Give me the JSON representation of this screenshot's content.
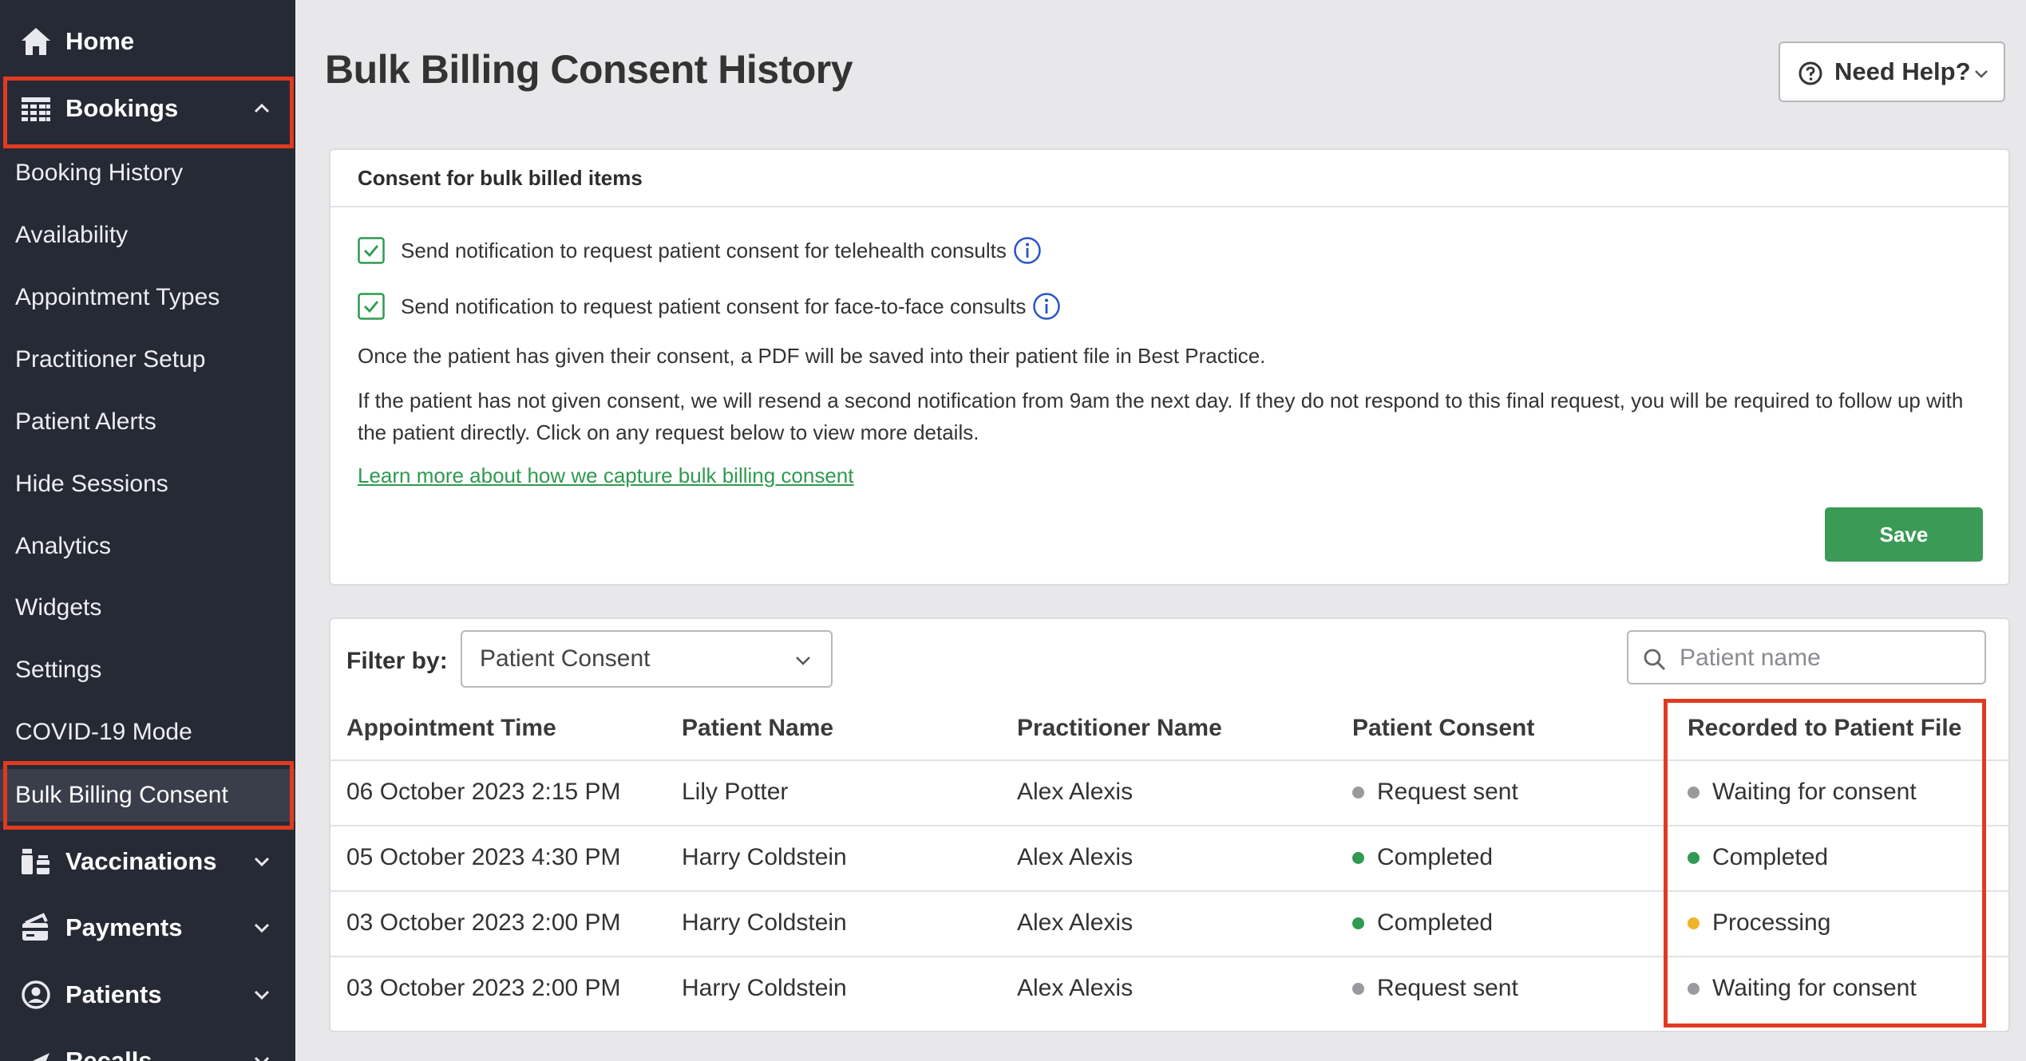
{
  "sidebar": {
    "home_label": "Home",
    "bookings_label": "Bookings",
    "sub_items": [
      {
        "label": "Booking History"
      },
      {
        "label": "Availability"
      },
      {
        "label": "Appointment Types"
      },
      {
        "label": "Practitioner Setup"
      },
      {
        "label": "Patient Alerts"
      },
      {
        "label": "Hide Sessions"
      },
      {
        "label": "Analytics"
      },
      {
        "label": "Widgets"
      },
      {
        "label": "Settings"
      },
      {
        "label": "COVID-19 Mode"
      },
      {
        "label": "Bulk Billing Consent",
        "active": true
      }
    ],
    "vaccinations_label": "Vaccinations",
    "payments_label": "Payments",
    "patients_label": "Patients",
    "recalls_label": "Recalls"
  },
  "header": {
    "title": "Bulk Billing Consent History",
    "help_label": "Need Help?"
  },
  "consent": {
    "heading": "Consent for bulk billed items",
    "telehealth_label": "Send notification to request patient consent for telehealth consults",
    "telehealth_checked": true,
    "face_label": "Send notification to request patient consent for face-to-face consults",
    "face_checked": true,
    "para1": "Once the patient has given their consent, a PDF will be saved into their patient file in Best Practice.",
    "para2": "If the patient has not given consent, we will resend a second notification from 9am the next day. If they do not respond to this final request, you will be required to follow up with the patient directly. Click on any request below to view more details.",
    "learn_link": "Learn more about how we capture bulk billing consent",
    "save_label": "Save"
  },
  "history": {
    "filter_label": "Filter by:",
    "filter_value": "Patient Consent",
    "search_placeholder": "Patient name",
    "columns": [
      "Appointment Time",
      "Patient Name",
      "Practitioner Name",
      "Patient Consent",
      "Recorded to Patient File"
    ],
    "rows": [
      {
        "time": "06 October 2023 2:15 PM",
        "patient": "Lily Potter",
        "practitioner": "Alex Alexis",
        "consent": "Request sent",
        "recorded": "Waiting for consent"
      },
      {
        "time": "05 October 2023 4:30 PM",
        "patient": "Harry Coldstein",
        "practitioner": "Alex Alexis",
        "consent": "Completed",
        "recorded": "Completed"
      },
      {
        "time": "03 October 2023 2:00 PM",
        "patient": "Harry Coldstein",
        "practitioner": "Alex Alexis",
        "consent": "Completed",
        "recorded": "Processing"
      },
      {
        "time": "03 October 2023 2:00 PM",
        "patient": "Harry Coldstein",
        "practitioner": "Alex Alexis",
        "consent": "Request sent",
        "recorded": "Waiting for consent"
      }
    ]
  },
  "colors": {
    "sidebar_bg": "#262a35",
    "accent_green": "#3a9a56",
    "highlight_red": "#e03a21",
    "status_grey": "#9a9a9e",
    "status_green": "#2f9a50",
    "status_amber": "#f0b429"
  }
}
